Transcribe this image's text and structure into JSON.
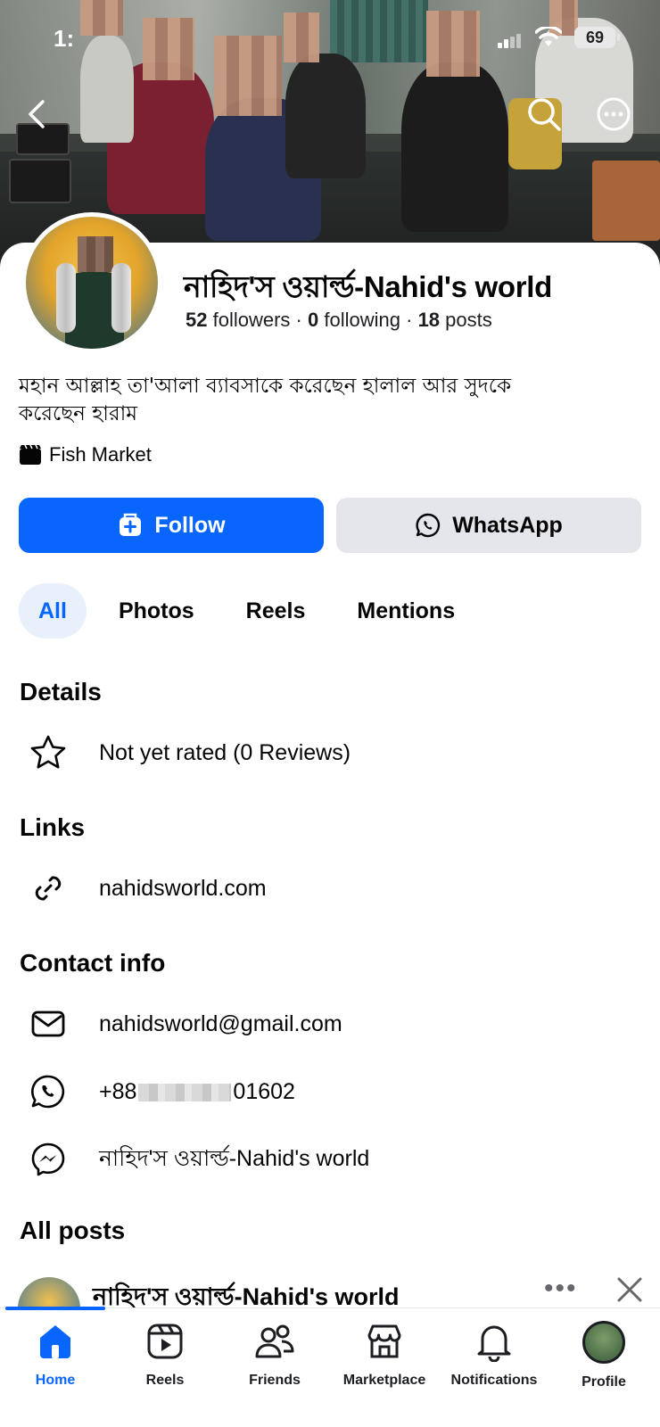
{
  "status_bar": {
    "time": "1:",
    "battery": "69"
  },
  "profile": {
    "name": "নাহিদ'স ওয়ার্ল্ড-Nahid's world",
    "followers_count": "52",
    "followers_label": "followers",
    "following_count": "0",
    "following_label": "following",
    "posts_count": "18",
    "posts_label": "posts",
    "separator": "·",
    "bio_line1": "মহান আল্লাহ তা'আলা ব্যাবসাকে করেছেন হালাল আর সুদকে",
    "bio_line2": "করেছেন হারাম",
    "category": "Fish Market"
  },
  "actions": {
    "follow_label": "Follow",
    "whatsapp_label": "WhatsApp"
  },
  "tabs": [
    {
      "label": "All",
      "active": true
    },
    {
      "label": "Photos",
      "active": false
    },
    {
      "label": "Reels",
      "active": false
    },
    {
      "label": "Mentions",
      "active": false
    }
  ],
  "details": {
    "title": "Details",
    "rating": "Not yet rated (0 Reviews)"
  },
  "links": {
    "title": "Links",
    "website": "nahidsworld.com"
  },
  "contact": {
    "title": "Contact info",
    "email": "nahidsworld@gmail.com",
    "phone_prefix": "+88",
    "phone_suffix": "01602",
    "messenger": "নাহিদ'স ওয়ার্ল্ড-Nahid's world"
  },
  "posts": {
    "title": "All posts",
    "first_author": "নাহিদ'স ওয়ার্ল্ড-Nahid's world",
    "more": "•••"
  },
  "bottom_nav": [
    {
      "label": "Home",
      "icon": "home-icon",
      "active": true
    },
    {
      "label": "Reels",
      "icon": "reels-icon",
      "active": false
    },
    {
      "label": "Friends",
      "icon": "friends-icon",
      "active": false
    },
    {
      "label": "Marketplace",
      "icon": "marketplace-icon",
      "active": false
    },
    {
      "label": "Notifications",
      "icon": "bell-icon",
      "active": false
    },
    {
      "label": "Profile",
      "icon": "profile-picture",
      "active": false
    }
  ],
  "colors": {
    "accent": "#0866ff",
    "button_gray": "#e4e6eb",
    "tab_active_bg": "#e7f0fb",
    "text": "#050505"
  }
}
